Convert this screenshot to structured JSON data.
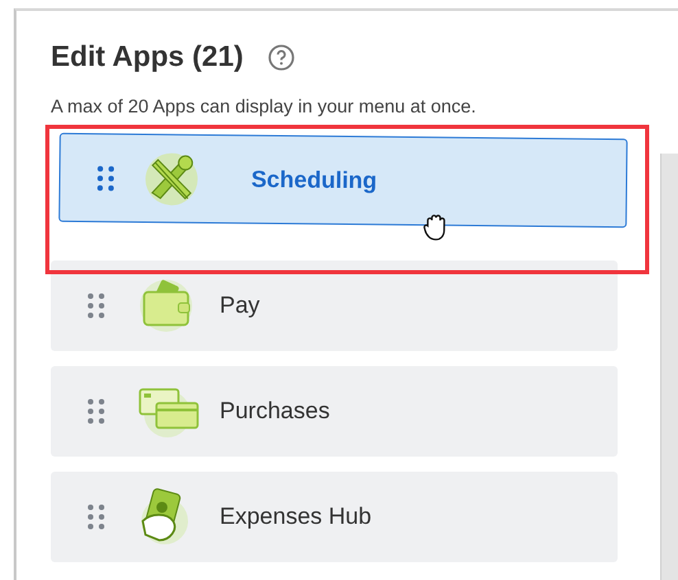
{
  "dialog": {
    "title": "Edit Apps (21)",
    "subtitle": "A max of 20 Apps can display in your menu at once."
  },
  "apps": [
    {
      "label": "Scheduling",
      "dragging": true
    },
    {
      "label": "Pay",
      "dragging": false
    },
    {
      "label": "Purchases",
      "dragging": false
    },
    {
      "label": "Expenses Hub",
      "dragging": false
    }
  ],
  "highlight": true
}
